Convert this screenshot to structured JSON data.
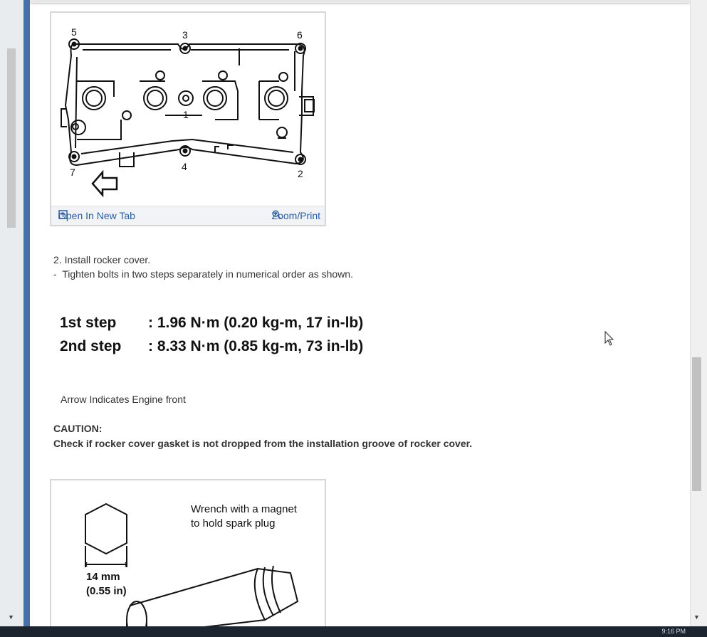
{
  "figure1": {
    "callouts": [
      "5",
      "3",
      "6",
      "1",
      "7",
      "4",
      "2"
    ],
    "open_tab_label": "Open In New Tab",
    "zoom_label": "Zoom/Print"
  },
  "instructions": {
    "step": "2. Install rocker cover.",
    "detail": "-  Tighten bolts in two steps separately in numerical order as shown."
  },
  "torque": [
    {
      "label": "1st step",
      "value": ": 1.96 N·m (0.20 kg-m, 17 in-lb)"
    },
    {
      "label": "2nd step",
      "value": ": 8.33 N·m (0.85 kg-m, 73 in-lb)"
    }
  ],
  "arrow_note": "Arrow Indicates Engine front",
  "caution": {
    "title": "CAUTION:",
    "text": "Check if rocker cover gasket is not dropped from the installation groove of rocker cover."
  },
  "figure2": {
    "caption_line1": "Wrench with a magnet",
    "caption_line2": "to hold spark plug",
    "size_mm": "14 mm",
    "size_in": "(0.55 in)"
  },
  "taskbar": {
    "clock": "9:16 PM"
  },
  "colors": {
    "link": "#2a5d9f",
    "left_strip": "#4a6fa5",
    "taskbar": "#1c2430"
  }
}
